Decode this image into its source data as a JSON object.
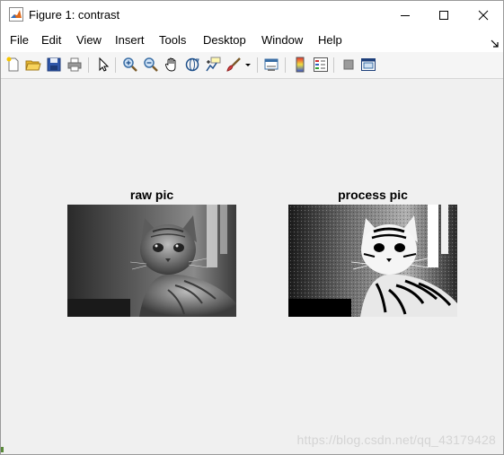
{
  "window": {
    "title": "Figure 1: contrast",
    "controls": [
      "minimize-icon",
      "maximize-icon",
      "close-icon"
    ]
  },
  "menu": {
    "items": [
      "File",
      "Edit",
      "View",
      "Insert",
      "Tools",
      "Desktop",
      "Window",
      "Help"
    ]
  },
  "toolbar": {
    "buttons": [
      "new-figure-icon",
      "open-file-icon",
      "save-icon",
      "print-icon",
      "pointer-icon",
      "zoom-in-icon",
      "zoom-out-icon",
      "pan-icon",
      "rotate-3d-icon",
      "data-cursor-icon",
      "brush-icon",
      "link-plot-icon",
      "colorbar-icon",
      "legend-icon",
      "hide-plot-tools-icon",
      "show-plot-tools-icon"
    ]
  },
  "axes": [
    {
      "title": "raw pic",
      "image": "grayscale kitten photo"
    },
    {
      "title": "process pic",
      "image": "contrast-enhanced kitten photo"
    }
  ],
  "watermark": "https://blog.csdn.net/qq_43179428",
  "colors": {
    "background": "#f0f0f0",
    "titlebar": "#ffffff"
  }
}
